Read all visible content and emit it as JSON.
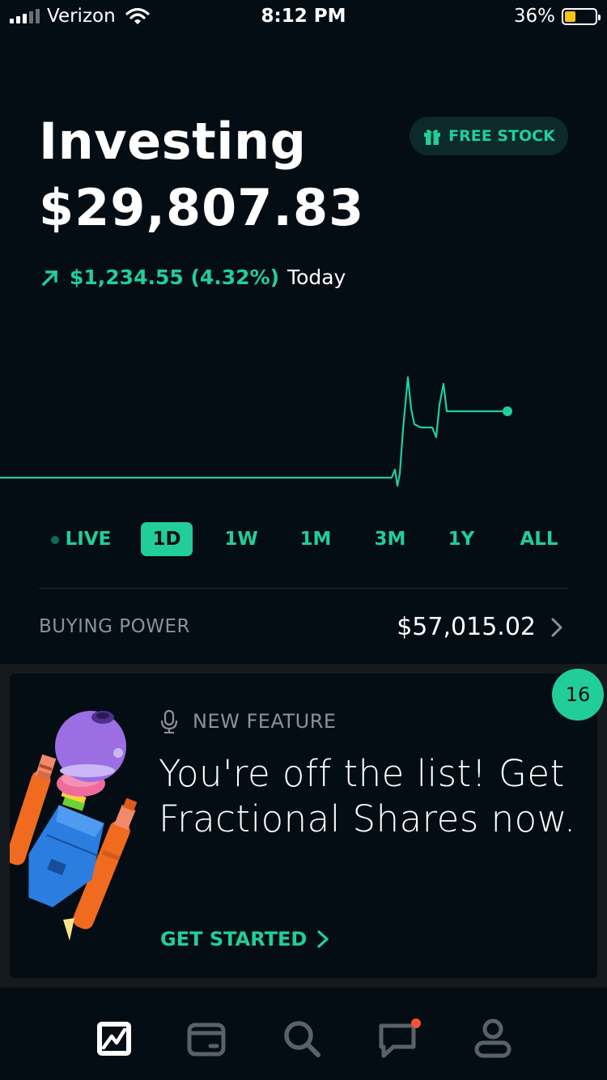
{
  "status_bar": {
    "carrier": "Verizon",
    "time": "8:12 PM",
    "battery": "36%",
    "battery_level": 0.36
  },
  "header": {
    "title": "Investing",
    "portfolio_value": "$29,807.83",
    "free_stock_label": "FREE STOCK",
    "change_amount": "$1,234.55 (4.32%)",
    "change_label": "Today"
  },
  "colors": {
    "accent": "#21ce99",
    "background": "#050d14",
    "muted": "#8d9296"
  },
  "ranges": {
    "live": "LIVE",
    "d1": "1D",
    "w1": "1W",
    "m1": "1M",
    "m3": "3M",
    "y1": "1Y",
    "all": "ALL",
    "active": "1D"
  },
  "buying_power": {
    "label": "BUYING POWER",
    "value": "$57,015.02"
  },
  "card": {
    "badge_count": "16",
    "eyebrow": "NEW FEATURE",
    "text": "You're off the list! Get Fractional Shares now.",
    "cta": "GET STARTED"
  },
  "tabbar": {
    "items": [
      "chart-icon",
      "wallet-icon",
      "search-icon",
      "messages-icon",
      "account-icon"
    ]
  }
}
